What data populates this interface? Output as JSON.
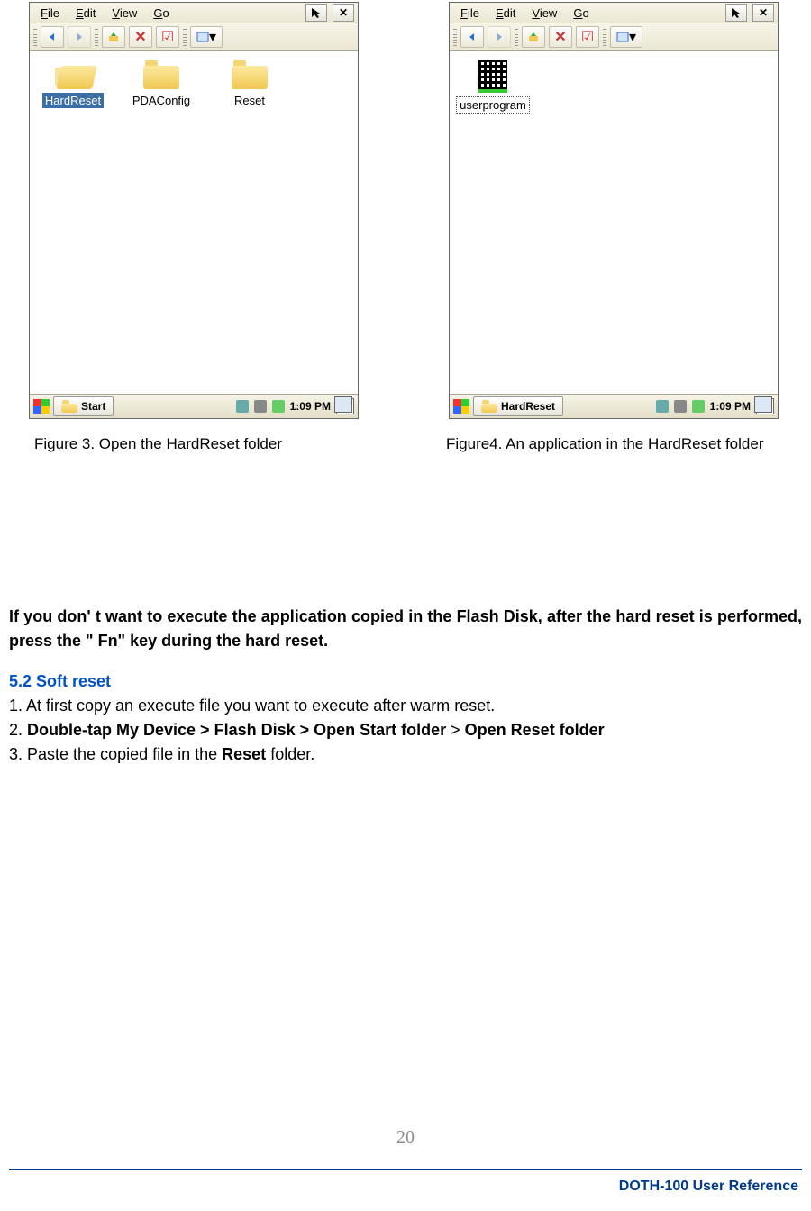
{
  "menus": {
    "file": "File",
    "edit": "Edit",
    "view": "View",
    "go": "Go"
  },
  "left": {
    "items": [
      {
        "label": "HardReset",
        "selected": true
      },
      {
        "label": "PDAConfig",
        "selected": false
      },
      {
        "label": "Reset",
        "selected": false
      }
    ],
    "start": "Start",
    "time": "1:09 PM",
    "caption": "Figure 3. Open the HardReset folder"
  },
  "right": {
    "items": [
      {
        "label": "userprogram",
        "boxed": true
      }
    ],
    "start": "HardReset",
    "time": "1:09 PM",
    "caption": "Figure4. An application in the HardReset folder"
  },
  "para": "If you don' t want to execute the application copied in the Flash Disk, after the hard reset is performed, press the \" Fn\"  key during the hard reset.",
  "section": "5.2 Soft reset",
  "steps": {
    "s1": "1. At first copy an execute file you want to execute after warm reset.",
    "s2a": "2. ",
    "s2b": "Double-tap My Device > Flash Disk > Open Start folder",
    "s2c": " > ",
    "s2d": "Open Reset folder",
    "s3a": "3. Paste the copied file in the ",
    "s3b": "Reset",
    "s3c": " folder."
  },
  "page_num": "20",
  "footer": "DOTH-100 User Reference"
}
